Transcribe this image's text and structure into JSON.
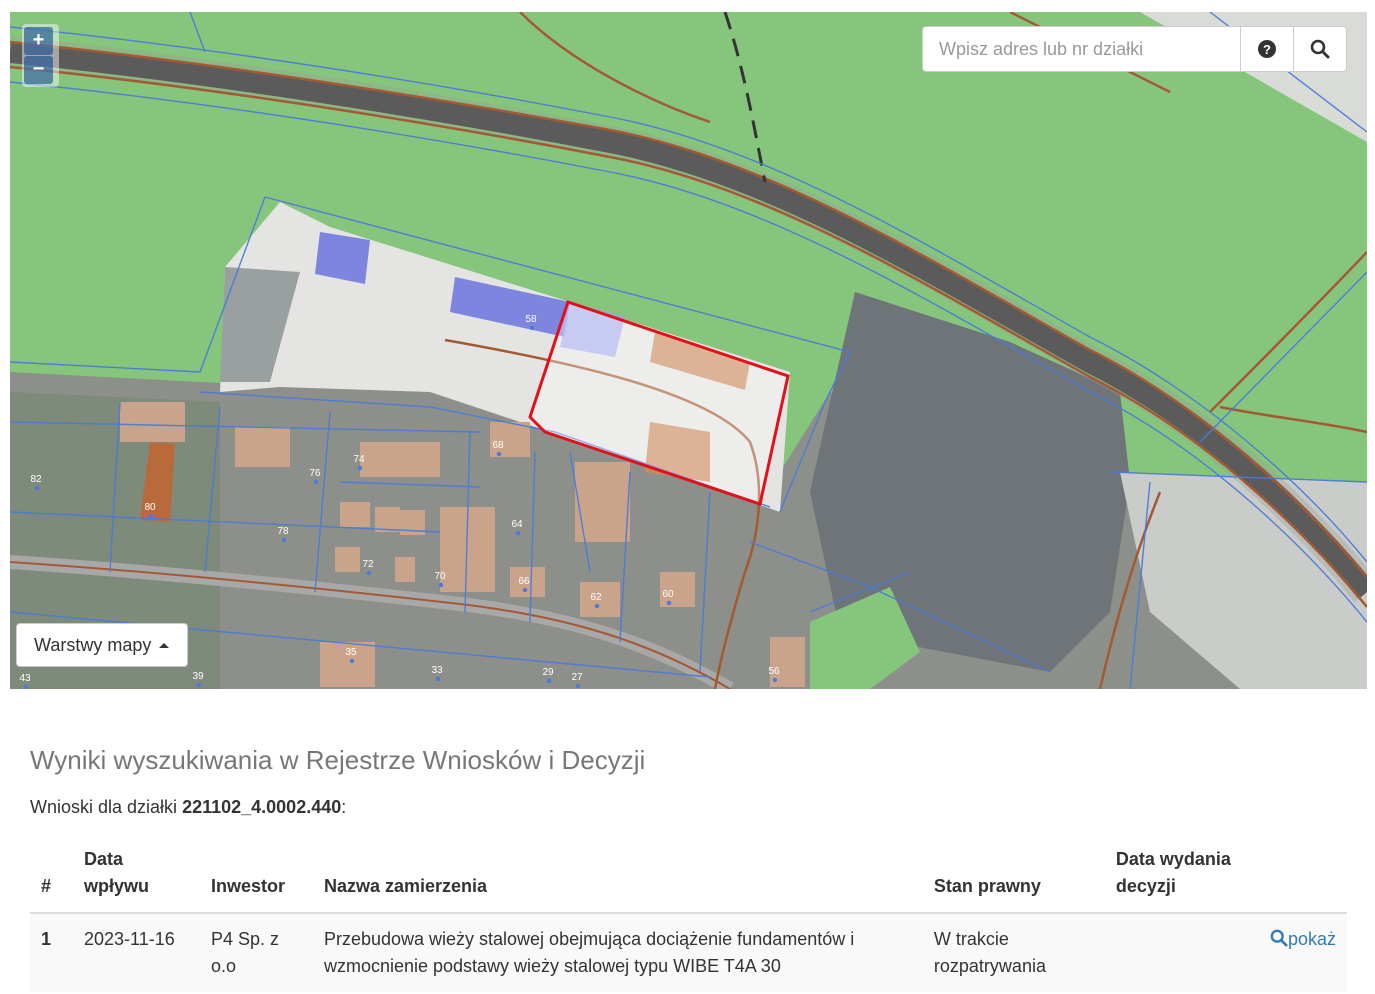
{
  "map": {
    "zoom_in": "+",
    "zoom_out": "−",
    "search_placeholder": "Wpisz adres lub nr działki",
    "help_icon": "question-circle-icon",
    "search_icon": "magnifier-icon",
    "layers_button": "Warstwy mapy",
    "parcel_labels": [
      "58",
      "82",
      "80",
      "76",
      "74",
      "68",
      "78",
      "64",
      "72",
      "70",
      "66",
      "62",
      "60",
      "35",
      "33",
      "29",
      "27",
      "56",
      "43",
      "39"
    ],
    "selected_parcel_color": "#e3101b"
  },
  "results": {
    "title": "Wyniki wyszukiwania w Rejestrze Wniosków i Decyzji",
    "subtitle_prefix": "Wnioski dla działki ",
    "parcel_id": "221102_4.0002.440",
    "subtitle_suffix": ":",
    "columns": [
      "#",
      "Data wpływu",
      "Inwestor",
      "Nazwa zamierzenia",
      "Stan prawny",
      "Data wydania decyzji",
      ""
    ],
    "rows": [
      {
        "num": "1",
        "date": "2023-11-16",
        "investor": "P4 Sp. z o.o",
        "name": "Przebudowa wieży stalowej obejmująca dociążenie fundamentów i wzmocnienie podstawy wieży stalowej typu WIBE T4A 30",
        "status": "W trakcie rozpatrywania",
        "decision_date": "",
        "action": "pokaż"
      }
    ]
  }
}
